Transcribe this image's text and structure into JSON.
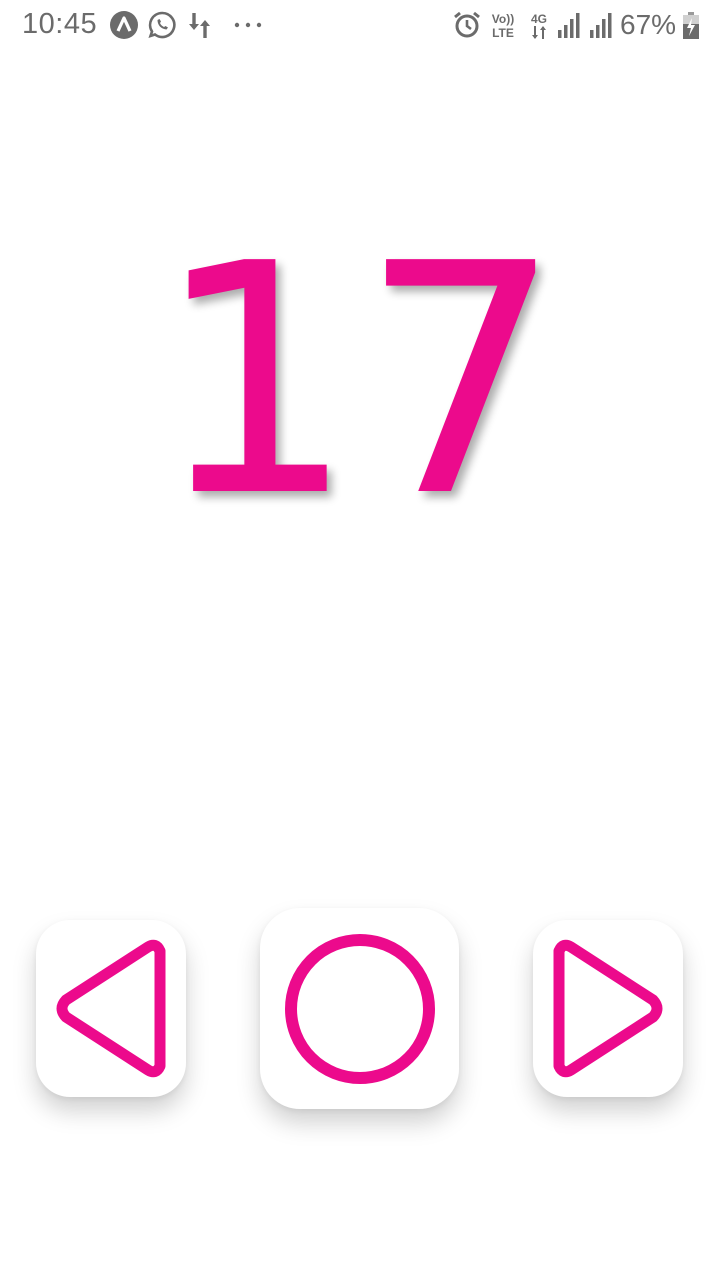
{
  "status_bar": {
    "time": "10:45",
    "left_icons": [
      "app-notification-icon",
      "whatsapp-icon",
      "data-transfer-icon",
      "more-dots-icon"
    ],
    "right_icons": [
      "alarm-icon",
      "volte-icon",
      "4g-icon",
      "signal-icon",
      "signal-icon",
      "battery-charging-icon"
    ],
    "volte_label_top": "Vo))",
    "volte_label_bottom": "LTE",
    "network_label": "4G",
    "battery_percent": "67%"
  },
  "counter": {
    "value": "17"
  },
  "controls": {
    "prev_icon": "triangle-left-icon",
    "center_icon": "circle-icon",
    "next_icon": "triangle-right-icon"
  },
  "colors": {
    "accent": "#EC0A8C",
    "status_text": "#6b6b6b",
    "background": "#ffffff"
  }
}
